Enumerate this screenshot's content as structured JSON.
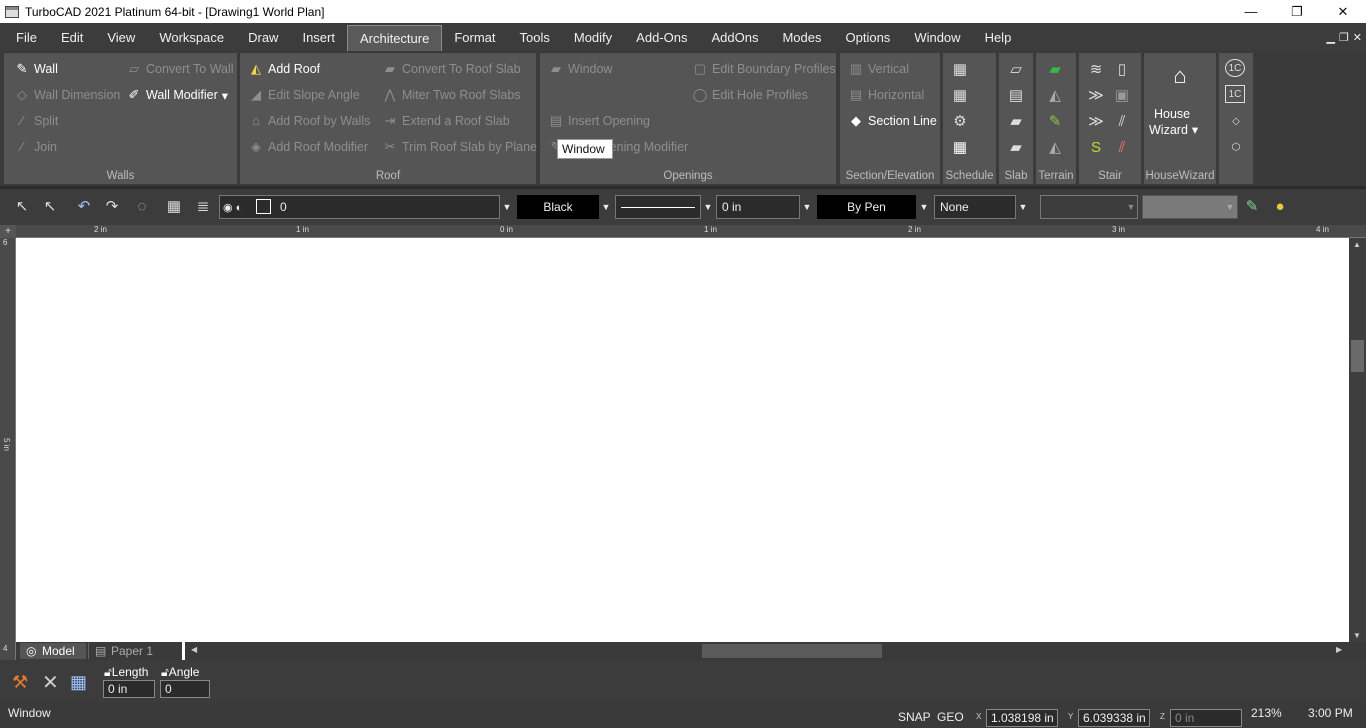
{
  "window": {
    "title": "TurboCAD 2021 Platinum 64-bit - [Drawing1 World Plan]",
    "minimize": "—",
    "restore": "❐",
    "close": "✕"
  },
  "menu": [
    "File",
    "Edit",
    "View",
    "Workspace",
    "Draw",
    "Insert",
    "Architecture",
    "Format",
    "Tools",
    "Modify",
    "Add-Ons",
    "AddOns",
    "Modes",
    "Options",
    "Window",
    "Help"
  ],
  "ribbon": {
    "walls": {
      "label": "Walls",
      "wall": "Wall",
      "convert_to_wall": "Convert To Wall",
      "wall_dimension": "Wall Dimension",
      "wall_modifier": "Wall Modifier",
      "split": "Split",
      "join": "Join"
    },
    "roof": {
      "label": "Roof",
      "add_roof": "Add Roof",
      "edit_slope_angle": "Edit Slope Angle",
      "add_roof_by_walls": "Add Roof by Walls",
      "add_roof_modifier": "Add Roof Modifier",
      "convert_to_roof_slab": "Convert To Roof Slab",
      "miter_two_roof_slabs": "Miter Two Roof Slabs",
      "extend_a_roof_slab": "Extend a Roof Slab",
      "trim_roof_slab_by_plane": "Trim Roof Slab by Plane"
    },
    "openings": {
      "label": "Openings",
      "window": "Window",
      "insert_opening": "Insert Opening",
      "edit_opening_modifier": "Edit Opening Modifier",
      "edit_boundary_profiles": "Edit Boundary Profiles",
      "edit_hole_profiles": "Edit Hole Profiles"
    },
    "section": {
      "label": "Section/Elevation",
      "vertical": "Vertical",
      "horizontal": "Horizontal",
      "section_line": "Section Line"
    },
    "schedule": {
      "label": "Schedule"
    },
    "slab": {
      "label": "Slab"
    },
    "terrain": {
      "label": "Terrain"
    },
    "stair": {
      "label": "Stair"
    },
    "housewizard": {
      "label": "HouseWizard",
      "house": "House",
      "wizard": "Wizard"
    }
  },
  "tooltip": "Window",
  "propbar": {
    "layer": "0",
    "color": "Black",
    "width": "0 in",
    "pen": "By Pen",
    "fill": "None"
  },
  "ruler": {
    "top": [
      "2 in",
      "1 in",
      "0 in",
      "1 in",
      "2 in",
      "3 in",
      "4 in"
    ],
    "left": [
      "6",
      "5 in",
      "4"
    ]
  },
  "tabs": {
    "model": "Model",
    "paper": "Paper 1"
  },
  "cmdbar": {
    "length_label": "Length",
    "angle_label": "Angle",
    "length_value": "0 in",
    "angle_value": "0"
  },
  "status": {
    "message": "Window",
    "snap": "SNAP",
    "geo": "GEO",
    "x": "1.038198 in",
    "y": "6.039338 in",
    "z": "0 in",
    "zoom": "213%",
    "time": "3:00 PM",
    "x_label": "X",
    "y_label": "Y",
    "z_label": "Z"
  }
}
